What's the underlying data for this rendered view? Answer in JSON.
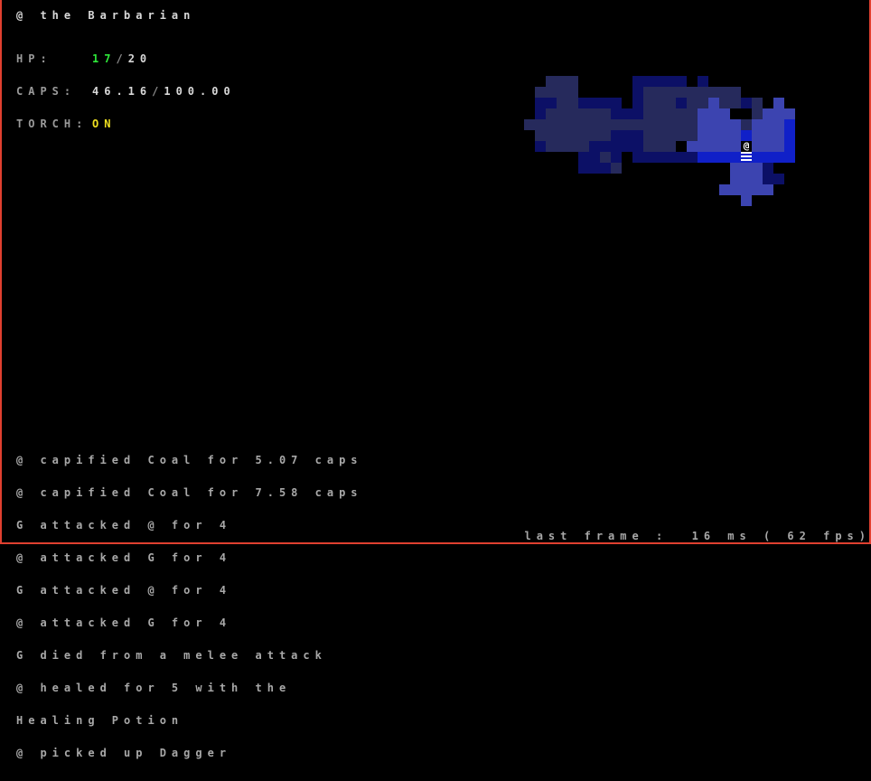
{
  "hud": {
    "title": "@ the Barbarian",
    "hp_label": "HP:",
    "hp_current": "17",
    "hp_sep": "/",
    "hp_max": "20",
    "caps_label": "CAPS:",
    "caps_current": "46.16",
    "caps_sep": "/",
    "caps_max": "100.00",
    "torch_label": "TORCH:",
    "torch_value": "ON"
  },
  "log": [
    "@ capified Coal for 5.07 caps",
    "@ capified Coal for 7.58 caps",
    "G attacked @ for 4",
    "@ attacked G for 4",
    "G attacked @ for 4",
    "@ attacked G for 4",
    "G died from a melee attack",
    "@ healed for 5 with the",
    "Healing Potion",
    "@ picked up Dagger"
  ],
  "fps_text": "last frame :  16 ms ( 62 fps)",
  "player_glyph": "@",
  "colors": {
    "border": "#e04030",
    "hp_value": "#2ee83a",
    "torch_on": "#f0e020",
    "tile_remembered": "#262a5c",
    "tile_dark": "#0c1066",
    "tile_lit": "#3c44b0",
    "tile_edge": "#1020c8"
  }
}
